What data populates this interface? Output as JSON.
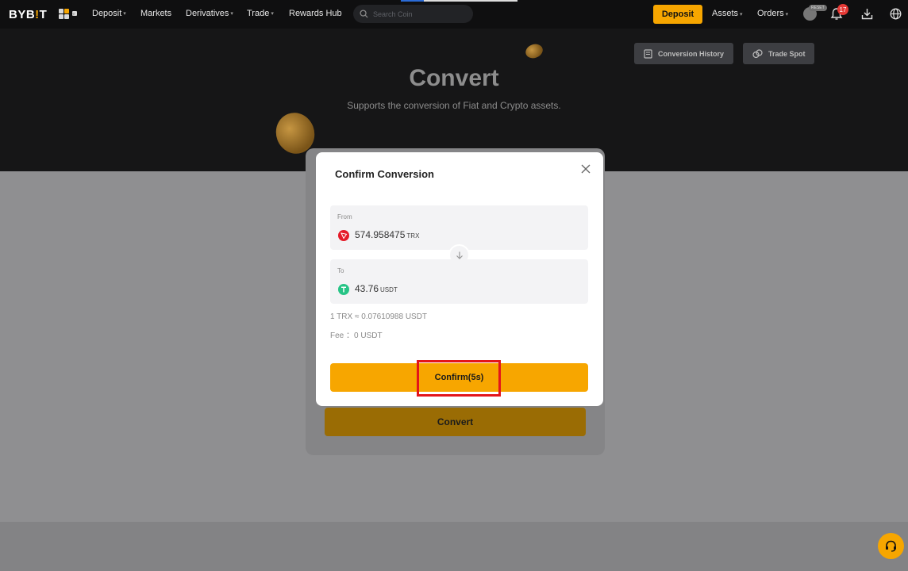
{
  "brand": {
    "logo_left": "BYB",
    "logo_bang": "!",
    "logo_right": "T"
  },
  "nav": {
    "items": [
      {
        "label": "Deposit",
        "has_caret": true
      },
      {
        "label": "Markets",
        "has_caret": false
      },
      {
        "label": "Derivatives",
        "has_caret": true
      },
      {
        "label": "Trade",
        "has_caret": true
      },
      {
        "label": "Rewards Hub",
        "has_caret": false
      }
    ],
    "search_placeholder": "Search Coin",
    "deposit_button": "Deposit",
    "assets": "Assets",
    "orders": "Orders",
    "avatar_badge": "RESET",
    "notification_count": "17",
    "caret": "▾"
  },
  "hero": {
    "title": "Convert",
    "subtitle": "Supports the conversion of Fiat and Crypto assets.",
    "conversion_history": "Conversion History",
    "trade_spot": "Trade Spot"
  },
  "background": {
    "convert_button": "Convert"
  },
  "modal": {
    "title": "Confirm Conversion",
    "from_label": "From",
    "from_amount": "574.958475",
    "from_currency": "TRX",
    "to_label": "To",
    "to_amount": "43.76",
    "to_currency": "USDT",
    "rate": "1 TRX ≈ 0.07610988 USDT",
    "fee": "Fee ：0 USDT",
    "confirm_button": "Confirm(5s)"
  },
  "colors": {
    "accent": "#f7a600",
    "nav_bg": "#0f0f10",
    "highlight_frame": "#e3151a",
    "trx": "#e51a28",
    "usdt": "#27c486"
  },
  "icons": [
    "apps-grid-icon",
    "search-icon",
    "bell-icon",
    "download-icon",
    "globe-icon",
    "close-icon",
    "arrow-down-icon",
    "history-icon",
    "spot-icon",
    "support-headset-icon"
  ]
}
